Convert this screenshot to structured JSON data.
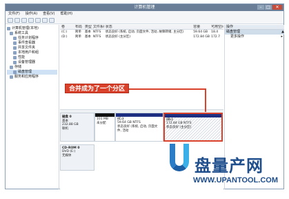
{
  "window": {
    "title": "计算机管理"
  },
  "menu": [
    "文件(F)",
    "操作(A)",
    "查看(V)",
    "帮助(H)"
  ],
  "tree": [
    {
      "label": "计算机管理(本地)",
      "indent": 0
    },
    {
      "label": "系统工具",
      "indent": 1
    },
    {
      "label": "任务计划程序",
      "indent": 2
    },
    {
      "label": "事件查看器",
      "indent": 2
    },
    {
      "label": "共享文件夹",
      "indent": 2
    },
    {
      "label": "本地用户和组",
      "indent": 2
    },
    {
      "label": "性能",
      "indent": 2
    },
    {
      "label": "设备管理器",
      "indent": 2
    },
    {
      "label": "存储",
      "indent": 1
    },
    {
      "label": "磁盘管理",
      "indent": 2,
      "selected": true
    },
    {
      "label": "服务和应用程序",
      "indent": 1
    }
  ],
  "volume_table": {
    "headers": [
      "卷",
      "布局",
      "类型",
      "文件系统",
      "状态",
      "容量",
      "可用空间"
    ],
    "rows": [
      [
        "(C:)",
        "简单",
        "基本",
        "NTFS",
        "状态良好 (系统, 启动, 页面文件, 活动, 故障转储, 主分区)",
        "59.64 GB",
        "18.4"
      ],
      [
        "(D:)",
        "简单",
        "基本",
        "NTFS",
        "状态良好 (主分区)",
        "172.84 GB",
        "172.7"
      ]
    ]
  },
  "annotation": "合并成为了一个分区",
  "disks": [
    {
      "name": "磁盘 0",
      "type": "基本",
      "size": "232.88 GB",
      "status": "联机",
      "partitions": [
        {
          "title": "",
          "line1": "101 MB",
          "line2": "未分配",
          "kind": "unalloc"
        },
        {
          "title": "(C:)",
          "line1": "59.64 GB NTFS",
          "line2": "状态良好 (系统, 启动, 页面文件, 活动",
          "kind": "primary"
        },
        {
          "title": "(D:)",
          "line1": "172.84 GB NTFS",
          "line2": "状态良好 (主分区)",
          "kind": "hatched"
        }
      ]
    },
    {
      "name": "CD-ROM 0",
      "type": "DVD (E:)",
      "size": "",
      "status": "无媒体",
      "partitions": []
    }
  ],
  "operations": {
    "header": "操作",
    "section": "磁盘管理",
    "items": [
      "更多操作"
    ]
  },
  "watermark": {
    "cn": "盘量产网",
    "en": "WWW.UPANTOOL.COM"
  }
}
